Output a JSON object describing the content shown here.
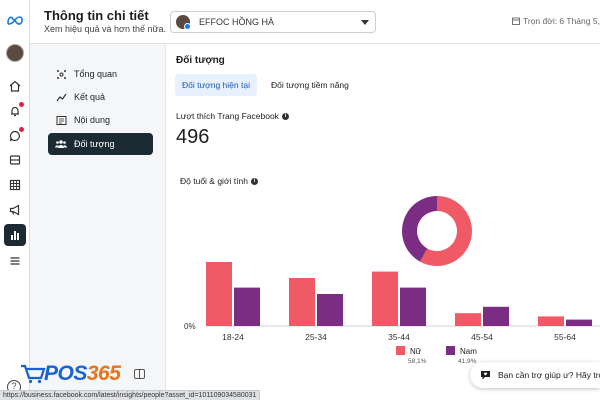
{
  "rail": {
    "items": [
      {
        "name": "meta-logo-icon"
      },
      {
        "name": "profile-avatar"
      },
      {
        "name": "home-icon"
      },
      {
        "name": "notifications-icon"
      },
      {
        "name": "messages-icon"
      },
      {
        "name": "posts-icon"
      },
      {
        "name": "calendar-grid-icon"
      },
      {
        "name": "megaphone-icon"
      },
      {
        "name": "insights-icon"
      },
      {
        "name": "menu-icon"
      }
    ]
  },
  "header": {
    "title": "Thông tin chi tiết",
    "subtitle": "Xem hiệu quả và hơn thế nữa.",
    "page_name": "EFFOC HỒNG HÀ",
    "date_range": "Trọn đời: 6 Tháng 5,"
  },
  "sidebar": {
    "items": [
      {
        "label": "Tổng quan",
        "icon": "overview-icon"
      },
      {
        "label": "Kết quả",
        "icon": "results-icon"
      },
      {
        "label": "Nội dung",
        "icon": "content-icon"
      },
      {
        "label": "Đối tượng",
        "icon": "audience-icon",
        "active": true
      }
    ]
  },
  "main": {
    "section_title": "Đối tượng",
    "tabs": [
      {
        "label": "Đối tượng hiện tại",
        "active": true
      },
      {
        "label": "Đối tượng tiềm năng",
        "active": false
      }
    ],
    "likes_label": "Lượt thích Trang Facebook",
    "likes_value": "496",
    "age_gender_label": "Độ tuổi & giới tính"
  },
  "chart_data": {
    "type": "bar",
    "categories": [
      "18-24",
      "25-34",
      "35-44",
      "45-54",
      "55-64"
    ],
    "series": [
      {
        "name": "Nữ",
        "color": "#ef5a66",
        "values": [
          20,
          15,
          17,
          4,
          3
        ]
      },
      {
        "name": "Nam",
        "color": "#7b2d84",
        "values": [
          12,
          10,
          12,
          6,
          2
        ]
      }
    ],
    "ylim": [
      0,
      30
    ],
    "y_tick_label": "0%",
    "donut": {
      "values": [
        58.1,
        41.9
      ],
      "labels": [
        "Nữ",
        "Nam"
      ],
      "colors": [
        "#ef5a66",
        "#7b2d84"
      ]
    },
    "legend": [
      {
        "label": "Nữ",
        "pct": "58,1%",
        "color": "#ef5a66"
      },
      {
        "label": "Nam",
        "pct": "41,9%",
        "color": "#7b2d84"
      }
    ]
  },
  "help": {
    "text": "Bạn cần trợ giúp ư? Hãy trò"
  },
  "logo": {
    "text_a": "POS",
    "text_b": "365"
  },
  "statusbar": {
    "url": "https://business.facebook.com/latest/insights/people?asset_id=101109034580031"
  }
}
